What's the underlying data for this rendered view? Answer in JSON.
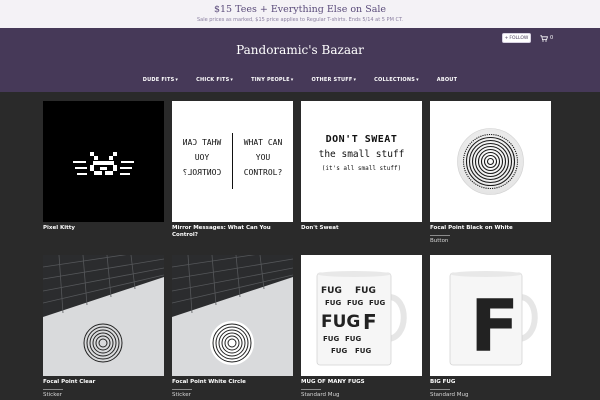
{
  "promo": {
    "title": "$15 Tees + Everything Else on Sale",
    "subtitle": "Sale prices as marked, $15 price applies to Regular T-shirts. Ends 5/14 at 5 PM CT."
  },
  "header": {
    "store_name": "Pandoramic's Bazaar",
    "follow_label": "FOLLOW",
    "cart_count": "0",
    "nav": [
      "DUDE FITS",
      "CHICK FITS",
      "TINY PEOPLE",
      "OTHER STUFF",
      "COLLECTIONS",
      "ABOUT"
    ]
  },
  "products": [
    {
      "title": "Pixel Kitty",
      "type": ""
    },
    {
      "title": "Mirror Messages: What Can You Control?",
      "type": ""
    },
    {
      "title": "Don't Sweat",
      "type": ""
    },
    {
      "title": "Focal Point Black on White",
      "type": "Button"
    },
    {
      "title": "Focal Point Clear",
      "type": "Sticker"
    },
    {
      "title": "Focal Point White Circle",
      "type": "Sticker"
    },
    {
      "title": "MUG OF MANY FUGS",
      "type": "Standard Mug"
    },
    {
      "title": "BIG FUG",
      "type": "Standard Mug"
    }
  ],
  "artwork": {
    "mirror_lines": [
      "WHAT CAN",
      "YOU",
      "CONTROL?"
    ],
    "dont_sweat": [
      "DON'T SWEAT",
      "the small stuff",
      "(it's all small stuff)"
    ],
    "mug_word": "FUG",
    "big_fug_letter": "F"
  },
  "colors": {
    "header_bg": "#463958",
    "page_bg": "#2a2a2a",
    "promo_bg": "#f4f2f6",
    "promo_text": "#5a4b7a"
  },
  "icons": {
    "follow": "plus-icon",
    "cart": "cart-icon",
    "nav_dropdown": "chevron-down-icon"
  }
}
